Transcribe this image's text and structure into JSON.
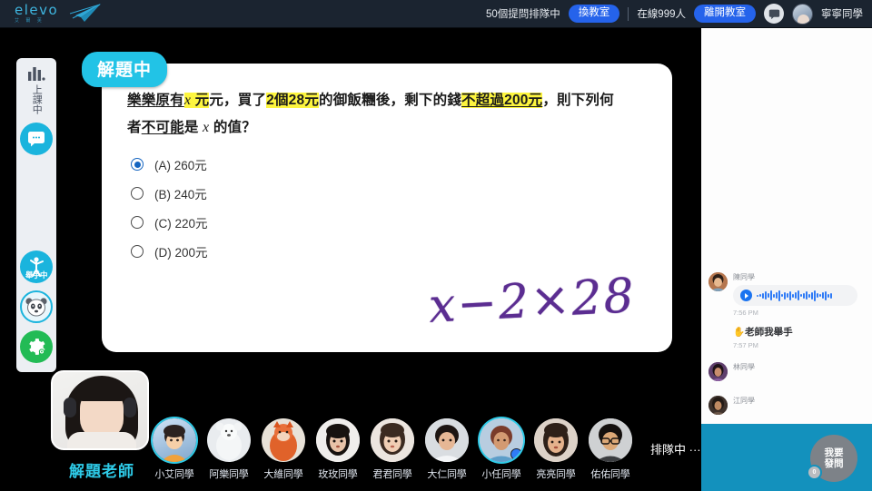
{
  "header": {
    "logo_text": "elevo",
    "logo_sub": "艾 爾 芙",
    "queue_status": "50個提問排隊中",
    "switch_room_label": "換教室",
    "online_count": "在線999人",
    "leave_room_label": "離開教室",
    "user_name": "寧寧同學"
  },
  "rail": {
    "class_status": "上課中",
    "items": [
      {
        "name": "chart-icon",
        "label": "上課中"
      },
      {
        "name": "chat-icon",
        "label": ""
      },
      {
        "name": "raise-hand-icon",
        "label": "舉手中"
      },
      {
        "name": "mascot-icon",
        "label": ""
      },
      {
        "name": "settings-gear-icon",
        "label": ""
      }
    ],
    "hand_label": "舉手中"
  },
  "board": {
    "badge": "解題中",
    "question": {
      "line1_a": "樂樂",
      "line1_b": "原有",
      "line1_var": "x",
      "line1_c": "元，買了",
      "line1_hl1": "2個28元",
      "line1_d": "的御飯糰後，剩下的錢",
      "line1_hl2": "不超過200元",
      "line1_e": "，則下列何",
      "line2_a": "者",
      "line2_u": "不可能",
      "line2_b": "是",
      "line2_var": "x",
      "line2_c": "的值？"
    },
    "options": [
      {
        "label": "(A) 260元",
        "selected": true
      },
      {
        "label": "(B) 240元",
        "selected": false
      },
      {
        "label": "(C) 220元",
        "selected": false
      },
      {
        "label": "(D) 200元",
        "selected": false
      }
    ],
    "handwriting": "x−2×28"
  },
  "teacher": {
    "name": "解題老師"
  },
  "students": [
    {
      "name": "小艾同學",
      "highlighted": true,
      "mic": false
    },
    {
      "name": "阿樂同學",
      "highlighted": false,
      "mic": false
    },
    {
      "name": "大維同學",
      "highlighted": false,
      "mic": false
    },
    {
      "name": "玫玫同學",
      "highlighted": false,
      "mic": false
    },
    {
      "name": "君君同學",
      "highlighted": false,
      "mic": false
    },
    {
      "name": "大仁同學",
      "highlighted": false,
      "mic": false
    },
    {
      "name": "小任同學",
      "highlighted": true,
      "mic": true
    },
    {
      "name": "亮亮同學",
      "highlighted": false,
      "mic": false
    },
    {
      "name": "佑佑同學",
      "highlighted": false,
      "mic": false
    }
  ],
  "queue_label": "排隊中 ···",
  "chat": {
    "messages": [
      {
        "type": "voice",
        "name": "陳同學",
        "time": "7:56 PM",
        "text": ""
      },
      {
        "type": "text",
        "name": "",
        "time": "7:57 PM",
        "text": "✋老師我舉手"
      },
      {
        "type": "name",
        "name": "林同學",
        "time": "",
        "text": ""
      },
      {
        "type": "name",
        "name": "江同學",
        "time": "",
        "text": ""
      }
    ],
    "ask_button_line1": "我要",
    "ask_button_line2": "發問",
    "ask_badge": "0"
  },
  "colors": {
    "accent_cyan": "#22c3e6",
    "accent_blue": "#2563eb",
    "chat_panel_blue": "#1391bd",
    "header_bg": "#1b2430",
    "highlight_yellow": "#fdf53f",
    "ink_purple": "#5b2d91"
  }
}
